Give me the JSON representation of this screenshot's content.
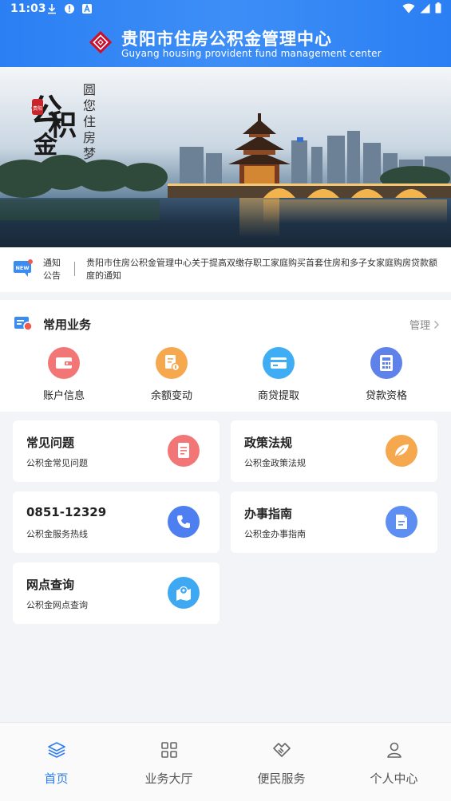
{
  "status_bar": {
    "time": "11:03",
    "left_icons": [
      "download-icon",
      "alert-icon",
      "app-a-icon"
    ],
    "right_icons": [
      "wifi-icon",
      "signal-icon",
      "battery-icon"
    ]
  },
  "header": {
    "title": "贵阳市住房公积金管理中心",
    "subtitle": "Guyang housing provident fund management center",
    "logo": "diamond-logo",
    "colors": {
      "background": "#2f84f4",
      "logo": "#c8102e"
    }
  },
  "banner": {
    "calligraphy": "公积金",
    "seal": "贵阳",
    "slogan": "圆您住房梦",
    "image": "night-scenery-pavilion-bridge"
  },
  "notice": {
    "label": "通知公告",
    "badge": "NEW",
    "text": "贵阳市住房公积金管理中心关于提高双缴存职工家庭购买首套住房和多子女家庭购房贷款额度的通知"
  },
  "common_services": {
    "title": "常用业务",
    "manage_label": "管理",
    "items": [
      {
        "label": "账户信息",
        "icon": "wallet-icon",
        "color": "#f06a6a"
      },
      {
        "label": "余额变动",
        "icon": "balance-doc-icon",
        "color": "#f5a24a"
      },
      {
        "label": "商贷提取",
        "icon": "card-icon",
        "color": "#39a7f2"
      },
      {
        "label": "贷款资格",
        "icon": "calculator-icon",
        "color": "#5b7de8"
      }
    ]
  },
  "cards": [
    {
      "title": "常见问题",
      "subtitle": "公积金常见问题",
      "icon": "document-icon",
      "color": "#f06a6a"
    },
    {
      "title": "政策法规",
      "subtitle": "公积金政策法规",
      "icon": "leaf-icon",
      "color": "#f5a24a"
    },
    {
      "title": "0851-12329",
      "subtitle": "公积金服务热线",
      "icon": "phone-icon",
      "color": "#4a7ff0"
    },
    {
      "title": "办事指南",
      "subtitle": "公积金办事指南",
      "icon": "guide-icon",
      "color": "#5b8ef0"
    },
    {
      "title": "网点查询",
      "subtitle": "公积金网点查询",
      "icon": "map-pin-icon",
      "color": "#3aa3f2"
    }
  ],
  "tabbar": {
    "active_color": "#2f7df0",
    "tabs": [
      {
        "label": "首页",
        "icon": "layers-icon",
        "active": true
      },
      {
        "label": "业务大厅",
        "icon": "grid-icon",
        "active": false
      },
      {
        "label": "便民服务",
        "icon": "handshake-icon",
        "active": false
      },
      {
        "label": "个人中心",
        "icon": "person-icon",
        "active": false
      }
    ]
  }
}
